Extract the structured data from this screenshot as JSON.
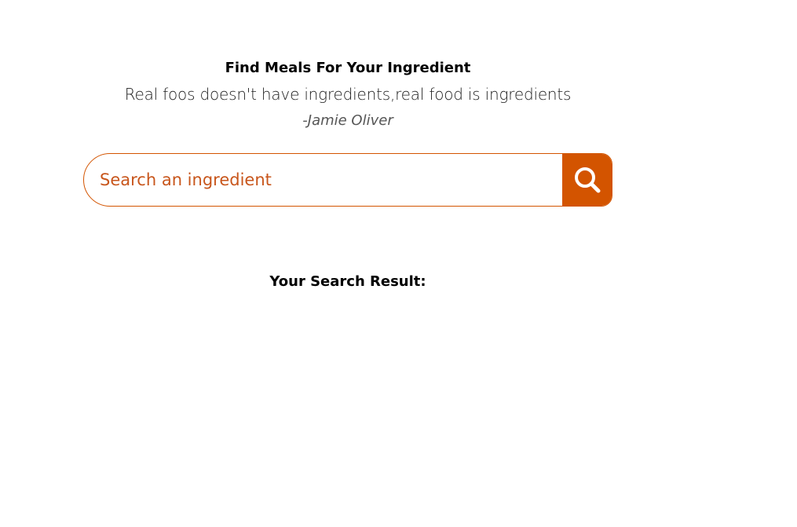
{
  "header": {
    "title": "Find Meals For Your Ingredient",
    "quote": "Real foos doesn't have ingredients,real food is ingredients",
    "author": "-Jamie Oliver"
  },
  "search": {
    "placeholder": "Search an ingredient",
    "value": "",
    "button_icon": "search-icon"
  },
  "results": {
    "heading": "Your Search Result:",
    "items": []
  },
  "colors": {
    "accent": "#d35400",
    "background": "#ffffff",
    "text": "#000000"
  }
}
